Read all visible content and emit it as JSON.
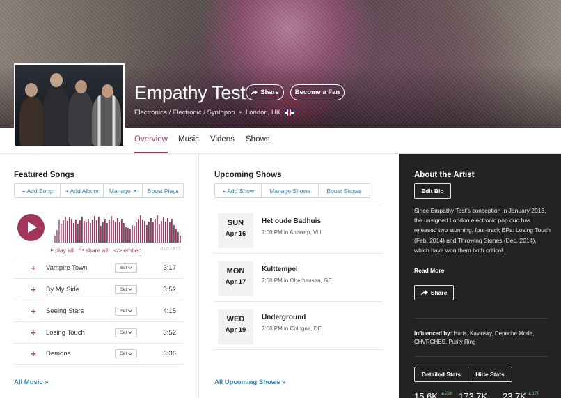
{
  "artist": {
    "name": "Empathy Test",
    "genres": "Electronica / Electronic / Synthpop",
    "location": "London, UK",
    "share_label": "Share",
    "fan_label": "Become a Fan"
  },
  "tabs": [
    {
      "label": "Overview",
      "active": true
    },
    {
      "label": "Music",
      "active": false
    },
    {
      "label": "Videos",
      "active": false
    },
    {
      "label": "Shows",
      "active": false
    }
  ],
  "featured": {
    "title": "Featured Songs",
    "buttons": [
      "+ Add Song",
      "+ Add Album",
      "Manage",
      "Boost Plays"
    ],
    "player": {
      "play_all": "play all",
      "share_all": "share all",
      "embed": "embed",
      "time": "0:00 / 3:17"
    },
    "songs": [
      {
        "title": "Vampire Town",
        "sell": "Sell",
        "duration": "3:17"
      },
      {
        "title": "By My Side",
        "sell": "Sell",
        "duration": "3:52"
      },
      {
        "title": "Seeing Stars",
        "sell": "Sell",
        "duration": "4:15"
      },
      {
        "title": "Losing Touch",
        "sell": "Sell",
        "duration": "3:52"
      },
      {
        "title": "Demons",
        "sell": "Sell",
        "duration": "3:36"
      }
    ],
    "all_link": "All Music »"
  },
  "shows": {
    "title": "Upcoming Shows",
    "buttons": [
      "+ Add Show",
      "Manage Shows",
      "Boost Shows"
    ],
    "items": [
      {
        "dow": "SUN",
        "date": "Apr 16",
        "venue": "Het oude Badhuis",
        "time": "7:00 PM",
        "city": "Antwerp, VLI"
      },
      {
        "dow": "MON",
        "date": "Apr 17",
        "venue": "Kulttempel",
        "time": "7:00 PM",
        "city": "Oberhausen, GE"
      },
      {
        "dow": "WED",
        "date": "Apr 19",
        "venue": "Underground",
        "time": "7:00 PM",
        "city": "Cologne, DE"
      }
    ],
    "in_word": "in",
    "all_link": "All Upcoming Shows »"
  },
  "about": {
    "title": "About the Artist",
    "edit_label": "Edit Bio",
    "bio": "Since Empathy Test's conception in January 2013, the unsigned London electronic pop duo has released two stunning, four-track EPs: Losing Touch (Feb. 2014) and Throwing Stones (Dec. 2014), which have won them both critical...",
    "read_more": "Read More",
    "share_label": "Share",
    "influenced_label": "Influenced by:",
    "influenced": "Hurts, Kavinsky, Depeche Mode, CHVRCHES, Purity Ring",
    "detailed_stats": "Detailed Stats",
    "hide_stats": "Hide Stats",
    "stats": [
      {
        "value": "15.6K",
        "delta": "▲226"
      },
      {
        "value": "173.7K",
        "delta": ""
      },
      {
        "value": "23.7K",
        "delta": "▲179"
      }
    ]
  },
  "colors": {
    "accent": "#a3355a",
    "link": "#2a84c6",
    "dark_panel": "#252223",
    "stat_up": "#5bc46b"
  }
}
